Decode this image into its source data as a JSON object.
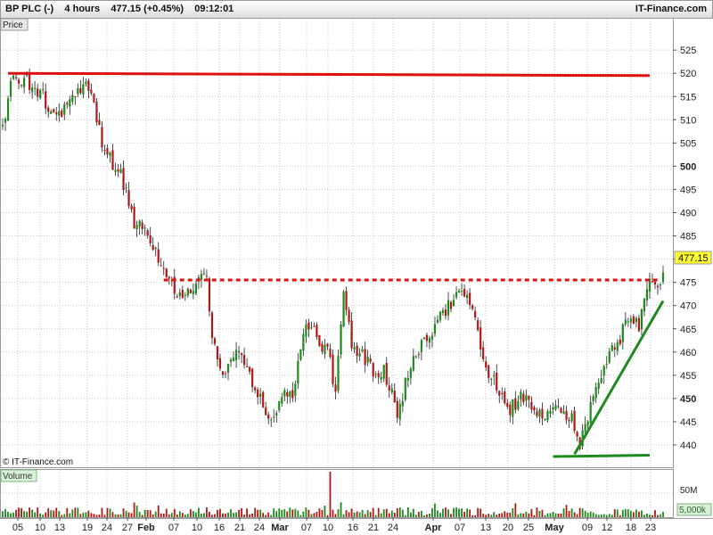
{
  "header": {
    "symbol": "BP PLC (-)",
    "timeframe": "4 hours",
    "price_change": "477.15 (+0.45%)",
    "time": "09:12:01",
    "brand": "IT-Finance.com"
  },
  "price_panel": {
    "label": "Price",
    "copyright": "© IT-Finance.com",
    "last_price_label": "477.15"
  },
  "volume_panel": {
    "label": "Volume",
    "y_tick_label": "50M",
    "scale_label": "5,000k"
  },
  "colors": {
    "up": "#1e8a1e",
    "down": "#b01818",
    "resistance": "#e01010",
    "support": "#1f8a1f",
    "grid": "#c8c8c8",
    "last_price_box": "#ffff33",
    "volume_label_box": "#d8f0d8"
  },
  "chart_data": {
    "type": "candlestick",
    "series_name": "BP PLC",
    "y_axis": {
      "range": [
        435,
        527
      ],
      "ticks": [
        440,
        445,
        450,
        455,
        460,
        465,
        470,
        475,
        480,
        485,
        490,
        495,
        500,
        505,
        510,
        515,
        520,
        525
      ],
      "bold_ticks": [
        450,
        500
      ]
    },
    "x_axis": {
      "tick_labels": [
        "05",
        "10",
        "13",
        "19",
        "24",
        "27",
        "Feb",
        "07",
        "10",
        "16",
        "21",
        "24",
        "Mar",
        "07",
        "10",
        "16",
        "21",
        "24",
        "Apr",
        "07",
        "13",
        "20",
        "25",
        "May",
        "09",
        "12",
        "18",
        "23"
      ],
      "month_labels": [
        "Feb",
        "Mar",
        "Apr",
        "May"
      ]
    },
    "close_path": [
      [
        0,
        508
      ],
      [
        3,
        518
      ],
      [
        8,
        519
      ],
      [
        15,
        515
      ],
      [
        20,
        510
      ],
      [
        27,
        516
      ],
      [
        32,
        517
      ],
      [
        38,
        503
      ],
      [
        44,
        498
      ],
      [
        49,
        488
      ],
      [
        55,
        484
      ],
      [
        60,
        478
      ],
      [
        66,
        472
      ],
      [
        70,
        473
      ],
      [
        74,
        478
      ],
      [
        76,
        476
      ],
      [
        78,
        462
      ],
      [
        82,
        455
      ],
      [
        86,
        460
      ],
      [
        90,
        458
      ],
      [
        97,
        448
      ],
      [
        101,
        446
      ],
      [
        105,
        452
      ],
      [
        108,
        450
      ],
      [
        111,
        462
      ],
      [
        114,
        466
      ],
      [
        118,
        462
      ],
      [
        121,
        460
      ],
      [
        124,
        452
      ],
      [
        127,
        472
      ],
      [
        130,
        462
      ],
      [
        134,
        459
      ],
      [
        138,
        456
      ],
      [
        142,
        456
      ],
      [
        147,
        447
      ],
      [
        152,
        457
      ],
      [
        157,
        462
      ],
      [
        160,
        465
      ],
      [
        166,
        470
      ],
      [
        171,
        474
      ],
      [
        175,
        469
      ],
      [
        178,
        462
      ],
      [
        181,
        455
      ],
      [
        184,
        453
      ],
      [
        188,
        447
      ],
      [
        193,
        450
      ],
      [
        198,
        448
      ],
      [
        204,
        446
      ],
      [
        208,
        448
      ],
      [
        212,
        446
      ],
      [
        215,
        440
      ],
      [
        218,
        446
      ],
      [
        224,
        457
      ],
      [
        229,
        462
      ],
      [
        234,
        468
      ],
      [
        237,
        466
      ],
      [
        240,
        474
      ],
      [
        243,
        475
      ],
      [
        246,
        475
      ]
    ],
    "resistance_line": {
      "start": [
        2,
        520
      ],
      "end": [
        241,
        519.5
      ]
    },
    "horizontal_level": {
      "value": 475.5,
      "style": "dashed",
      "from_bar": 60,
      "to_bar": 244
    },
    "uptrend_line": {
      "start": [
        213,
        438
      ],
      "end": [
        246,
        471
      ]
    },
    "support_line": {
      "start": [
        205,
        437.5
      ],
      "end": [
        241,
        437.8
      ]
    },
    "last_price": 477.15,
    "volume_spike_bar": 122
  }
}
